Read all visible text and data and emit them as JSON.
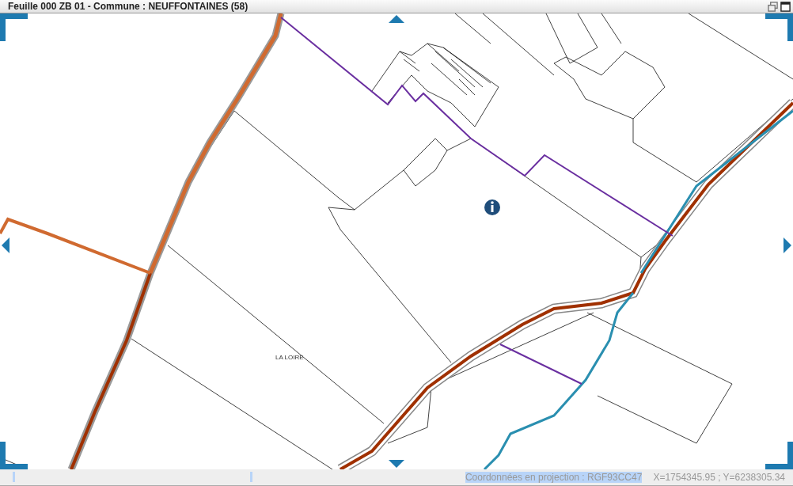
{
  "window": {
    "title": "Feuille 000 ZB 01 - Commune : NEUFFONTAINES (58)"
  },
  "map": {
    "place_label": "LA LOIRE"
  },
  "status_bar": {
    "projection": {
      "text": "Coordonnées en projection : RGF93CC47",
      "highlighted": true
    },
    "coordinates": "X=1754345.95 ; Y=6238305.34"
  }
}
